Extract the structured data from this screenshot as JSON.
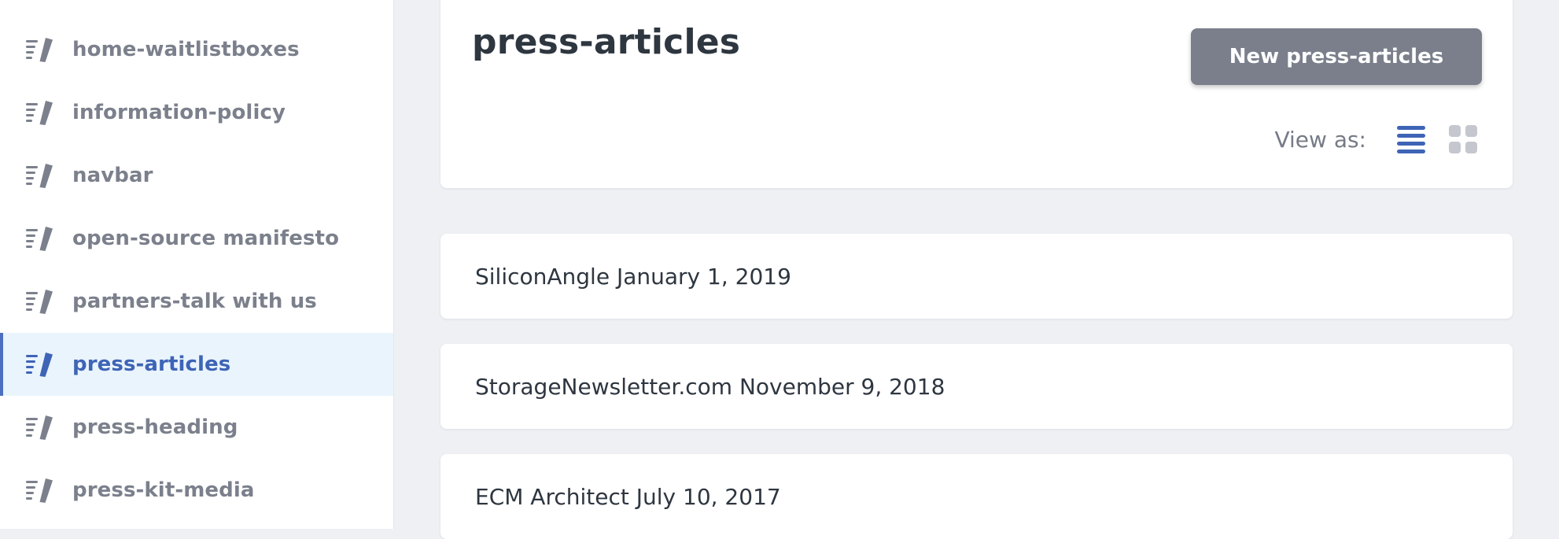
{
  "sidebar": {
    "items": [
      {
        "label": "home-waitlistboxes",
        "icon": "doc-edit-icon"
      },
      {
        "label": "information-policy",
        "icon": "doc-edit-icon"
      },
      {
        "label": "navbar",
        "icon": "doc-edit-icon"
      },
      {
        "label": "open-source manifesto",
        "icon": "doc-edit-icon"
      },
      {
        "label": "partners-talk with us",
        "icon": "doc-edit-icon"
      },
      {
        "label": "press-articles",
        "icon": "doc-edit-icon",
        "active": true
      },
      {
        "label": "press-heading",
        "icon": "doc-edit-icon"
      },
      {
        "label": "press-kit-media",
        "icon": "doc-edit-icon"
      }
    ]
  },
  "header": {
    "title": "press-articles",
    "new_button_label": "New press-articles",
    "view_as_label": "View as:",
    "view_modes": [
      "list-view-icon",
      "grid-view-icon"
    ],
    "active_view": "list"
  },
  "records": [
    {
      "title": "SiliconAngle January 1, 2019"
    },
    {
      "title": "StorageNewsletter.com November 9, 2018"
    },
    {
      "title": "ECM Architect July 10, 2017"
    }
  ],
  "colors": {
    "accent": "#3e64b6",
    "active_background": "#eaf4fd",
    "icon_gray": "#7b808c",
    "button_gray": "#7a7f8b",
    "page_background": "#eef0f4"
  }
}
